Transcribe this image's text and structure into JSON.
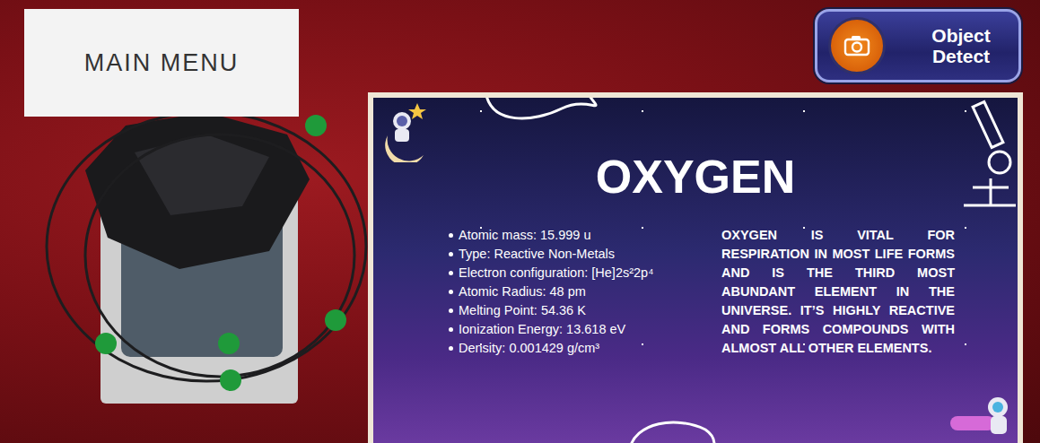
{
  "main_menu": {
    "label": "MAIN MENU"
  },
  "object_detect": {
    "label": "Object Detect"
  },
  "element_card": {
    "title": "OXYGEN",
    "facts": [
      "Atomic mass: 15.999 u",
      "Type: Reactive Non-Metals",
      "Electron configuration: [He]2s²2p⁴",
      "Atomic Radius: 48 pm",
      "Melting Point: 54.36 K",
      "Ionization Energy: 13.618 eV",
      "Density: 0.001429 g/cm³"
    ],
    "description": "OXYGEN IS VITAL FOR RESPIRATION IN MOST LIFE FORMS AND IS THE THIRD MOST ABUNDANT ELEMENT IN THE UNIVERSE. IT’S HIGHLY REACTIVE AND FORMS COMPOUNDS WITH ALMOST ALL OTHER ELEMENTS."
  }
}
